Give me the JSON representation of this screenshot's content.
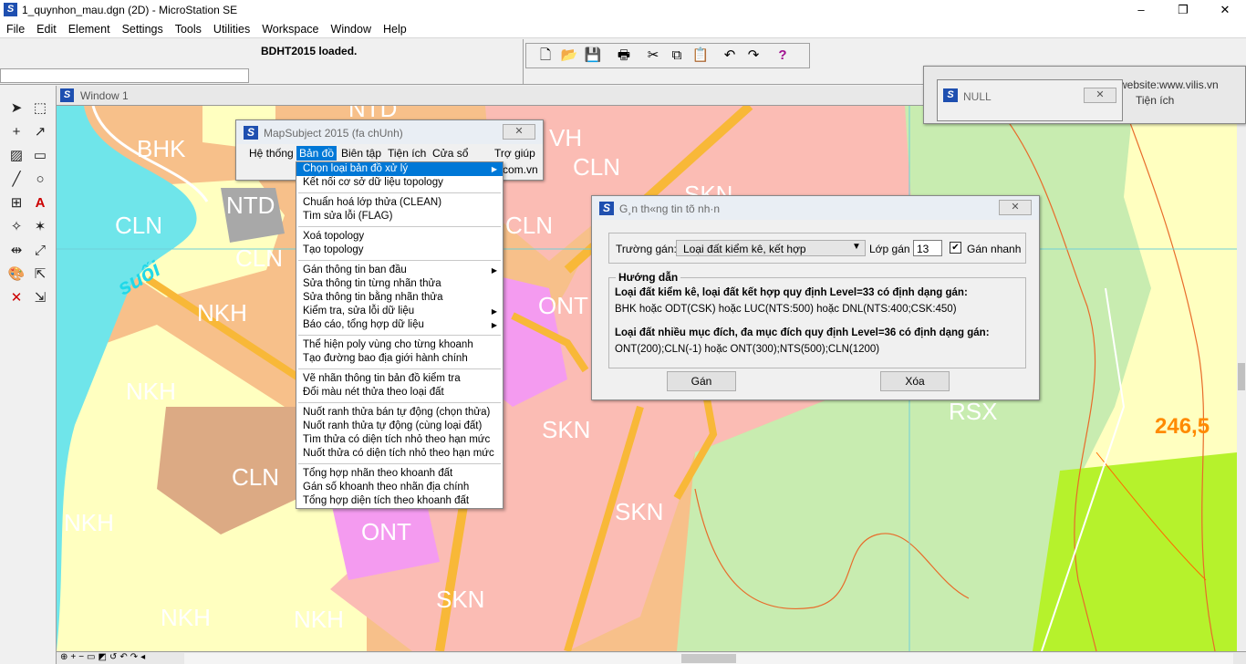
{
  "app": {
    "title": "1_quynhon_mau.dgn (2D) - MicroStation SE",
    "status_msg": "BDHT2015 loaded.",
    "minimize": "–",
    "maximize": "❐",
    "close": "✕"
  },
  "menu": [
    "File",
    "Edit",
    "Element",
    "Settings",
    "Tools",
    "Utilities",
    "Workspace",
    "Window",
    "Help"
  ],
  "view": {
    "title": "Window 1"
  },
  "map_labels": {
    "bhk": "BHK",
    "ntd1": "NTD",
    "ntd2": "NTD",
    "cln1": "CLN",
    "cln2": "CLN",
    "cln3": "CLN",
    "cln4": "CLN",
    "cln5": "CLN",
    "nkh1": "NKH",
    "nkh2": "NKH",
    "nkh3": "NKH",
    "nkh4": "NKH",
    "nkh5": "NKH",
    "vh": "VH",
    "skn1": "SKN",
    "skn2": "SKN",
    "skn3": "SKN",
    "skn4": "SKN",
    "ont1": "ONT",
    "ont2": "ONT",
    "rsx": "RSX",
    "suoi": "suối",
    "elev": "246,5"
  },
  "mapsubject": {
    "title": "MapSubject 2015 (fa chUnh)",
    "menu": [
      "Hệ thống",
      "Bản đồ",
      "Biên tập",
      "Tiện ích",
      "Cửa sổ",
      "Trợ giúp"
    ],
    "site": "com.vn"
  },
  "dropdown": [
    {
      "label": "Chọn loại bản đồ xử lý",
      "sub": true,
      "sel": true
    },
    {
      "label": "Kết nối cơ sở dữ liệu topology"
    },
    {
      "label": "Chuẩn hoá lớp thửa (CLEAN)"
    },
    {
      "label": "Tìm sửa lỗi (FLAG)"
    },
    {
      "label": "Xoá topology"
    },
    {
      "label": "Tạo topology"
    },
    {
      "label": "Gán thông tin ban đầu",
      "sub": true
    },
    {
      "label": "Sửa thông tin từng nhãn thửa"
    },
    {
      "label": "Sửa thông tin bằng nhãn thửa"
    },
    {
      "label": "Kiểm tra, sửa lỗi dữ liệu",
      "sub": true
    },
    {
      "label": "Báo cáo, tổng hợp dữ liệu",
      "sub": true
    },
    {
      "label": "Thể hiện poly vùng cho từng khoanh"
    },
    {
      "label": "Tạo đường bao địa giới hành chính"
    },
    {
      "label": "Vẽ nhãn thông tin bản đồ kiểm tra"
    },
    {
      "label": "Đổi màu nét thửa theo loại đất"
    },
    {
      "label": "Nuốt ranh thửa bán tự động (chọn thửa)"
    },
    {
      "label": "Nuốt ranh thửa tự động (cùng loại đất)"
    },
    {
      "label": "Tìm thửa có diện tích nhỏ theo hạn mức"
    },
    {
      "label": "Nuốt thửa có diện tích nhỏ theo hạn mức"
    },
    {
      "label": "Tổng hợp nhãn theo khoanh đất"
    },
    {
      "label": "Gán số khoanh theo nhãn địa chính"
    },
    {
      "label": "Tổng hợp diện tích theo khoanh đất"
    }
  ],
  "gan": {
    "title": "G¸n th«ng tin tõ nh·n",
    "truong_label": "Trường gán:",
    "truong_value": "Loại đất kiểm kê, kết hợp",
    "lop_label": "Lớp gán",
    "lop_value": "13",
    "nhanh_label": "Gán nhanh",
    "nhanh_checked": "✔",
    "huongdan": "Hướng dẫn",
    "h1": "Loại đất kiểm kê, loại đất kết hợp quy định Level=33 có định dạng gán:",
    "t1": "BHK hoặc ODT(CSK) hoặc LUC(NTS:500) hoặc DNL(NTS:400;CSK:450)",
    "h2": "Loại đất nhiều mục đích, đa mục đích quy định Level=36 có định dạng gán:",
    "t2": "ONT(200);CLN(-1) hoặc ONT(300);NTS(500);CLN(1200)",
    "btn_gan": "Gán",
    "btn_xoa": "Xóa"
  },
  "null_dlg": {
    "title": "NULL",
    "bg_website": "website:www.vilis.vn",
    "bg_tienich": "Tiện ích"
  },
  "colors": {
    "orange": "#f7c08a",
    "yellow": "#ffffc0",
    "pink": "#fbbcb4",
    "green": "#c8ecb0",
    "lime": "#b6f22c",
    "brown": "#dcaa84",
    "magenta": "#f49bf0"
  }
}
